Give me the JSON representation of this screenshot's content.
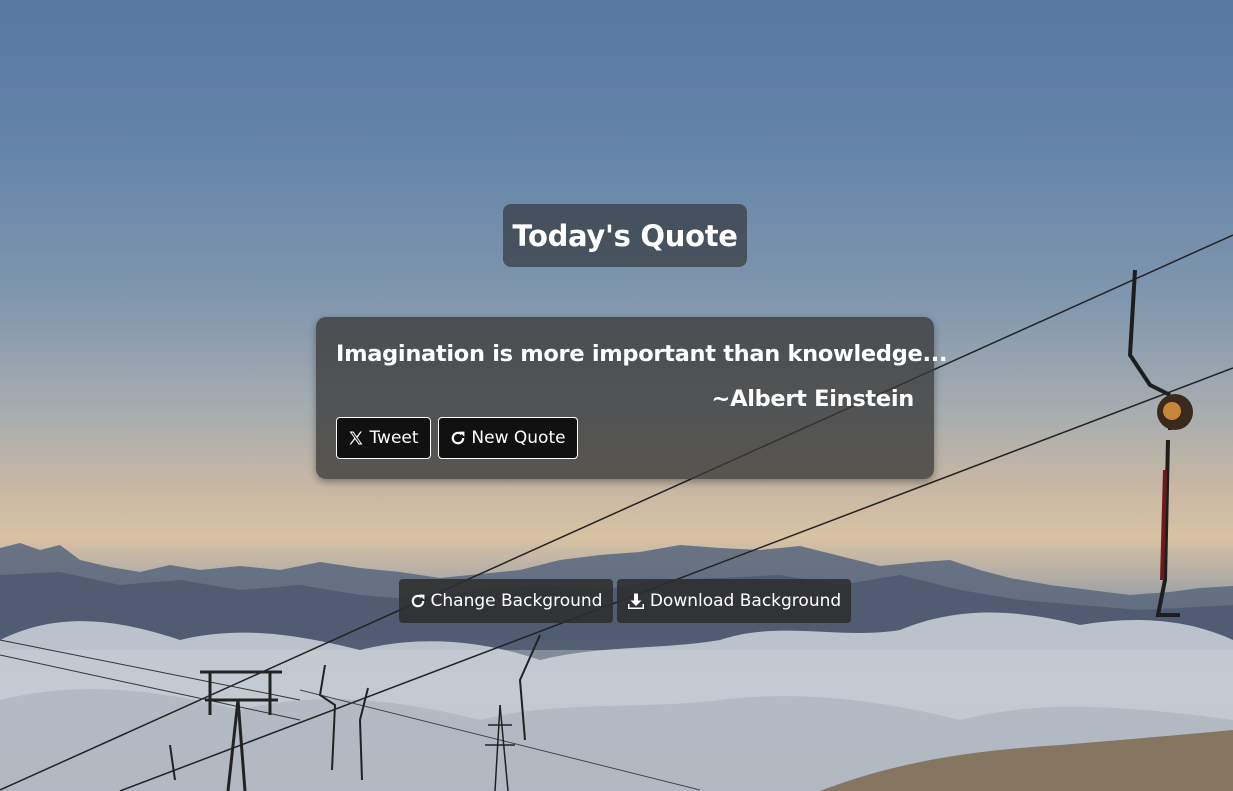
{
  "header": {
    "title": "Today's Quote"
  },
  "quote": {
    "text": "Imagination is more important than knowledge...",
    "author": "~Albert Einstein"
  },
  "quote_actions": {
    "tweet_label": "Tweet",
    "tweet_icon": "x-logo-icon",
    "new_quote_label": "New Quote",
    "new_quote_icon": "refresh-icon"
  },
  "background_actions": {
    "change_label": "Change Background",
    "change_icon": "refresh-icon",
    "download_label": "Download Background",
    "download_icon": "download-icon"
  },
  "colors": {
    "panel": "#3a3a3a",
    "button_dark": "#111111",
    "text": "#ffffff"
  }
}
